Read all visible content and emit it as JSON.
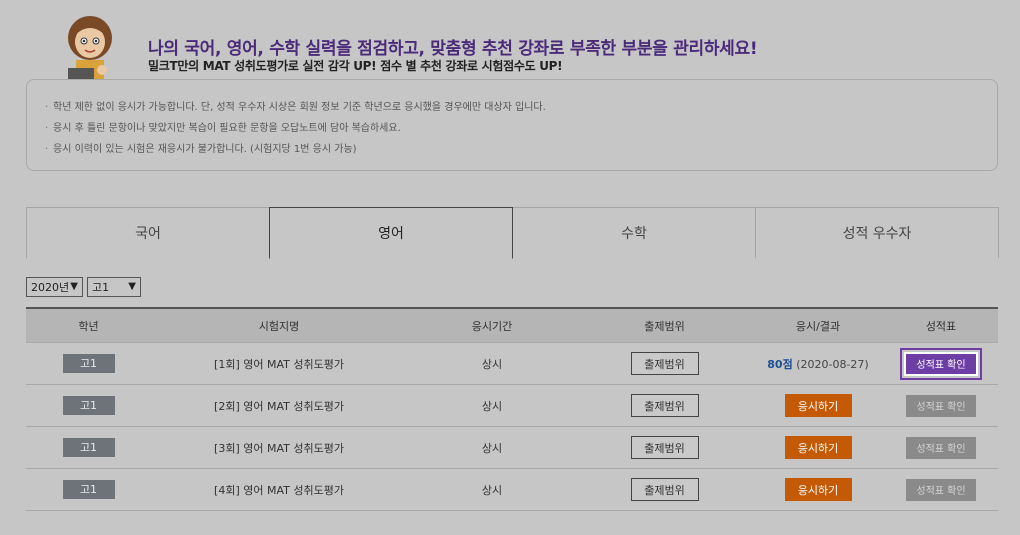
{
  "header": {
    "headline": "나의 국어, 영어, 수학 실력을 점검하고, 맞춤형 추천 강좌로 부족한 부분을 관리하세요!",
    "subline": "밀크T만의 MAT 성취도평가로 실전 감각 UP! 점수 별 추천 강좌로 시험점수도 UP!"
  },
  "notice": [
    "학년 제한 없이 응시가 가능합니다. 단, 성적 우수자 시상은 회원 정보 기준 학년으로 응시했을 경우에만 대상자 입니다.",
    "응시 후 틀린 문항이나 맞았지만 복습이 필요한 문항을 오답노트에 담아 복습하세요.",
    "응시 이력이 있는 시험은 재응시가 불가합니다. (시험지당 1번 응시 가능)"
  ],
  "tabs": [
    {
      "label": "국어"
    },
    {
      "label": "영어"
    },
    {
      "label": "수학"
    },
    {
      "label": "성적 우수자"
    }
  ],
  "active_tab": 1,
  "filters": {
    "year": "2020년",
    "grade": "고1"
  },
  "table": {
    "headers": [
      "학년",
      "시험지명",
      "응시기간",
      "출제범위",
      "응시/결과",
      "성적표"
    ],
    "rows": [
      {
        "grade": "고1",
        "name": "[1회] 영어 MAT 성취도평가",
        "period": "상시",
        "range": "출제범위",
        "score": "80점",
        "date": "(2020-08-27)",
        "report": "성적표 확인"
      },
      {
        "grade": "고1",
        "name": "[2회] 영어 MAT 성취도평가",
        "period": "상시",
        "range": "출제범위",
        "take": "응시하기",
        "report": "성적표 확인"
      },
      {
        "grade": "고1",
        "name": "[3회] 영어 MAT 성취도평가",
        "period": "상시",
        "range": "출제범위",
        "take": "응시하기",
        "report": "성적표 확인"
      },
      {
        "grade": "고1",
        "name": "[4회] 영어 MAT 성취도평가",
        "period": "상시",
        "range": "출제범위",
        "take": "응시하기",
        "report": "성적표 확인"
      }
    ]
  },
  "colors": {
    "headline": "#4b2a7a",
    "take_button": "#c55a06",
    "report_active": "#6d3fa5",
    "score": "#1c4f93"
  }
}
